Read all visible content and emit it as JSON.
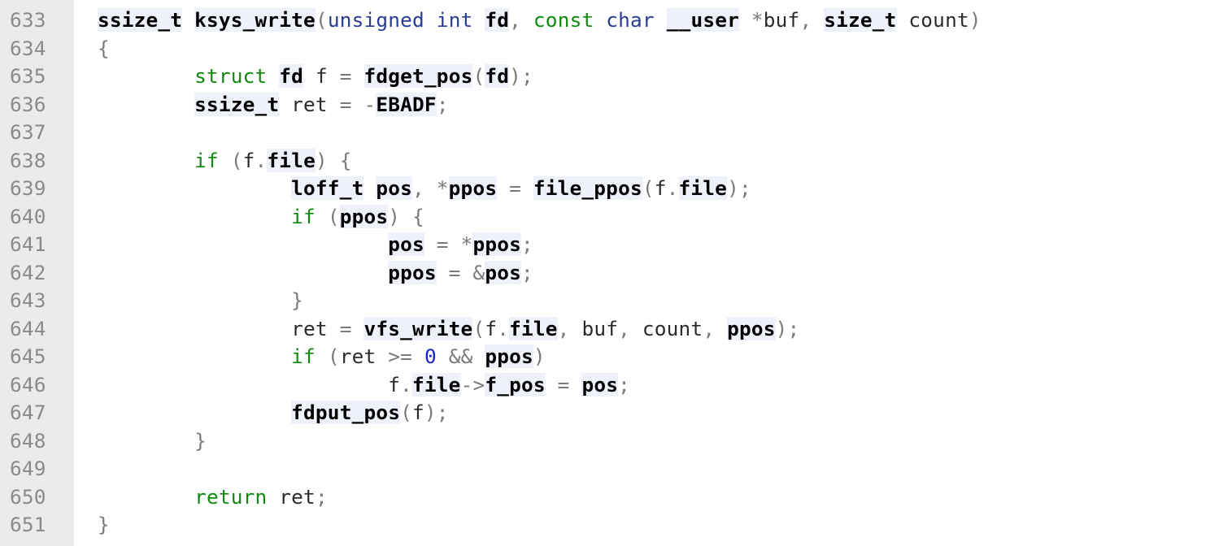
{
  "code_view": {
    "lines": [
      {
        "number": "633",
        "tokens": [
          {
            "t": "ssize_t",
            "k": "id"
          },
          {
            "t": " ",
            "k": "plain"
          },
          {
            "t": "ksys_write",
            "k": "id"
          },
          {
            "t": "(",
            "k": "op"
          },
          {
            "t": "unsigned int",
            "k": "type"
          },
          {
            "t": " ",
            "k": "plain"
          },
          {
            "t": "fd",
            "k": "id"
          },
          {
            "t": ", ",
            "k": "op"
          },
          {
            "t": "const",
            "k": "kw"
          },
          {
            "t": " ",
            "k": "plain"
          },
          {
            "t": "char",
            "k": "type"
          },
          {
            "t": " ",
            "k": "plain"
          },
          {
            "t": "__user",
            "k": "id"
          },
          {
            "t": " *",
            "k": "op"
          },
          {
            "t": "buf",
            "k": "plain"
          },
          {
            "t": ", ",
            "k": "op"
          },
          {
            "t": "size_t",
            "k": "id"
          },
          {
            "t": " count",
            "k": "plain"
          },
          {
            "t": ")",
            "k": "op"
          }
        ]
      },
      {
        "number": "634",
        "tokens": [
          {
            "t": "{",
            "k": "op"
          }
        ]
      },
      {
        "number": "635",
        "tokens": [
          {
            "t": "        ",
            "k": "plain"
          },
          {
            "t": "struct",
            "k": "kw"
          },
          {
            "t": " ",
            "k": "plain"
          },
          {
            "t": "fd",
            "k": "id"
          },
          {
            "t": " f ",
            "k": "plain"
          },
          {
            "t": "=",
            "k": "op"
          },
          {
            "t": " ",
            "k": "plain"
          },
          {
            "t": "fdget_pos",
            "k": "id"
          },
          {
            "t": "(",
            "k": "op"
          },
          {
            "t": "fd",
            "k": "id"
          },
          {
            "t": ");",
            "k": "op"
          }
        ]
      },
      {
        "number": "636",
        "tokens": [
          {
            "t": "        ",
            "k": "plain"
          },
          {
            "t": "ssize_t",
            "k": "id"
          },
          {
            "t": " ret ",
            "k": "plain"
          },
          {
            "t": "=",
            "k": "op"
          },
          {
            "t": " ",
            "k": "plain"
          },
          {
            "t": "-",
            "k": "op"
          },
          {
            "t": "EBADF",
            "k": "id"
          },
          {
            "t": ";",
            "k": "op"
          }
        ]
      },
      {
        "number": "637",
        "tokens": []
      },
      {
        "number": "638",
        "tokens": [
          {
            "t": "        ",
            "k": "plain"
          },
          {
            "t": "if",
            "k": "kw"
          },
          {
            "t": " ",
            "k": "plain"
          },
          {
            "t": "(",
            "k": "op"
          },
          {
            "t": "f",
            "k": "plain"
          },
          {
            "t": ".",
            "k": "op"
          },
          {
            "t": "file",
            "k": "id"
          },
          {
            "t": ") {",
            "k": "op"
          }
        ]
      },
      {
        "number": "639",
        "tokens": [
          {
            "t": "                ",
            "k": "plain"
          },
          {
            "t": "loff_t",
            "k": "id"
          },
          {
            "t": " ",
            "k": "plain"
          },
          {
            "t": "pos",
            "k": "id"
          },
          {
            "t": ", *",
            "k": "op"
          },
          {
            "t": "ppos",
            "k": "id"
          },
          {
            "t": " = ",
            "k": "op"
          },
          {
            "t": "file_ppos",
            "k": "id"
          },
          {
            "t": "(",
            "k": "op"
          },
          {
            "t": "f",
            "k": "plain"
          },
          {
            "t": ".",
            "k": "op"
          },
          {
            "t": "file",
            "k": "id"
          },
          {
            "t": ");",
            "k": "op"
          }
        ]
      },
      {
        "number": "640",
        "tokens": [
          {
            "t": "                ",
            "k": "plain"
          },
          {
            "t": "if",
            "k": "kw"
          },
          {
            "t": " ",
            "k": "plain"
          },
          {
            "t": "(",
            "k": "op"
          },
          {
            "t": "ppos",
            "k": "id"
          },
          {
            "t": ") {",
            "k": "op"
          }
        ]
      },
      {
        "number": "641",
        "tokens": [
          {
            "t": "                        ",
            "k": "plain"
          },
          {
            "t": "pos",
            "k": "id"
          },
          {
            "t": " = *",
            "k": "op"
          },
          {
            "t": "ppos",
            "k": "id"
          },
          {
            "t": ";",
            "k": "op"
          }
        ]
      },
      {
        "number": "642",
        "tokens": [
          {
            "t": "                        ",
            "k": "plain"
          },
          {
            "t": "ppos",
            "k": "id"
          },
          {
            "t": " = &",
            "k": "op"
          },
          {
            "t": "pos",
            "k": "id"
          },
          {
            "t": ";",
            "k": "op"
          }
        ]
      },
      {
        "number": "643",
        "tokens": [
          {
            "t": "                ",
            "k": "plain"
          },
          {
            "t": "}",
            "k": "op"
          }
        ]
      },
      {
        "number": "644",
        "tokens": [
          {
            "t": "                ",
            "k": "plain"
          },
          {
            "t": "ret ",
            "k": "plain"
          },
          {
            "t": "=",
            "k": "op"
          },
          {
            "t": " ",
            "k": "plain"
          },
          {
            "t": "vfs_write",
            "k": "id"
          },
          {
            "t": "(",
            "k": "op"
          },
          {
            "t": "f",
            "k": "plain"
          },
          {
            "t": ".",
            "k": "op"
          },
          {
            "t": "file",
            "k": "id"
          },
          {
            "t": ", ",
            "k": "op"
          },
          {
            "t": "buf",
            "k": "plain"
          },
          {
            "t": ", ",
            "k": "op"
          },
          {
            "t": "count",
            "k": "plain"
          },
          {
            "t": ", ",
            "k": "op"
          },
          {
            "t": "ppos",
            "k": "id"
          },
          {
            "t": ");",
            "k": "op"
          }
        ]
      },
      {
        "number": "645",
        "tokens": [
          {
            "t": "                ",
            "k": "plain"
          },
          {
            "t": "if",
            "k": "kw"
          },
          {
            "t": " ",
            "k": "plain"
          },
          {
            "t": "(",
            "k": "op"
          },
          {
            "t": "ret ",
            "k": "plain"
          },
          {
            "t": ">=",
            "k": "op"
          },
          {
            "t": " ",
            "k": "plain"
          },
          {
            "t": "0",
            "k": "num"
          },
          {
            "t": " && ",
            "k": "op"
          },
          {
            "t": "ppos",
            "k": "id"
          },
          {
            "t": ")",
            "k": "op"
          }
        ]
      },
      {
        "number": "646",
        "tokens": [
          {
            "t": "                        ",
            "k": "plain"
          },
          {
            "t": "f",
            "k": "plain"
          },
          {
            "t": ".",
            "k": "op"
          },
          {
            "t": "file",
            "k": "id"
          },
          {
            "t": "->",
            "k": "op"
          },
          {
            "t": "f_pos",
            "k": "id"
          },
          {
            "t": " = ",
            "k": "op"
          },
          {
            "t": "pos",
            "k": "id"
          },
          {
            "t": ";",
            "k": "op"
          }
        ]
      },
      {
        "number": "647",
        "tokens": [
          {
            "t": "                ",
            "k": "plain"
          },
          {
            "t": "fdput_pos",
            "k": "id"
          },
          {
            "t": "(",
            "k": "op"
          },
          {
            "t": "f",
            "k": "plain"
          },
          {
            "t": ");",
            "k": "op"
          }
        ]
      },
      {
        "number": "648",
        "tokens": [
          {
            "t": "        ",
            "k": "plain"
          },
          {
            "t": "}",
            "k": "op"
          }
        ]
      },
      {
        "number": "649",
        "tokens": []
      },
      {
        "number": "650",
        "tokens": [
          {
            "t": "        ",
            "k": "plain"
          },
          {
            "t": "return",
            "k": "kw"
          },
          {
            "t": " ret",
            "k": "plain"
          },
          {
            "t": ";",
            "k": "op"
          }
        ]
      },
      {
        "number": "651",
        "tokens": [
          {
            "t": "}",
            "k": "op"
          }
        ]
      }
    ]
  }
}
